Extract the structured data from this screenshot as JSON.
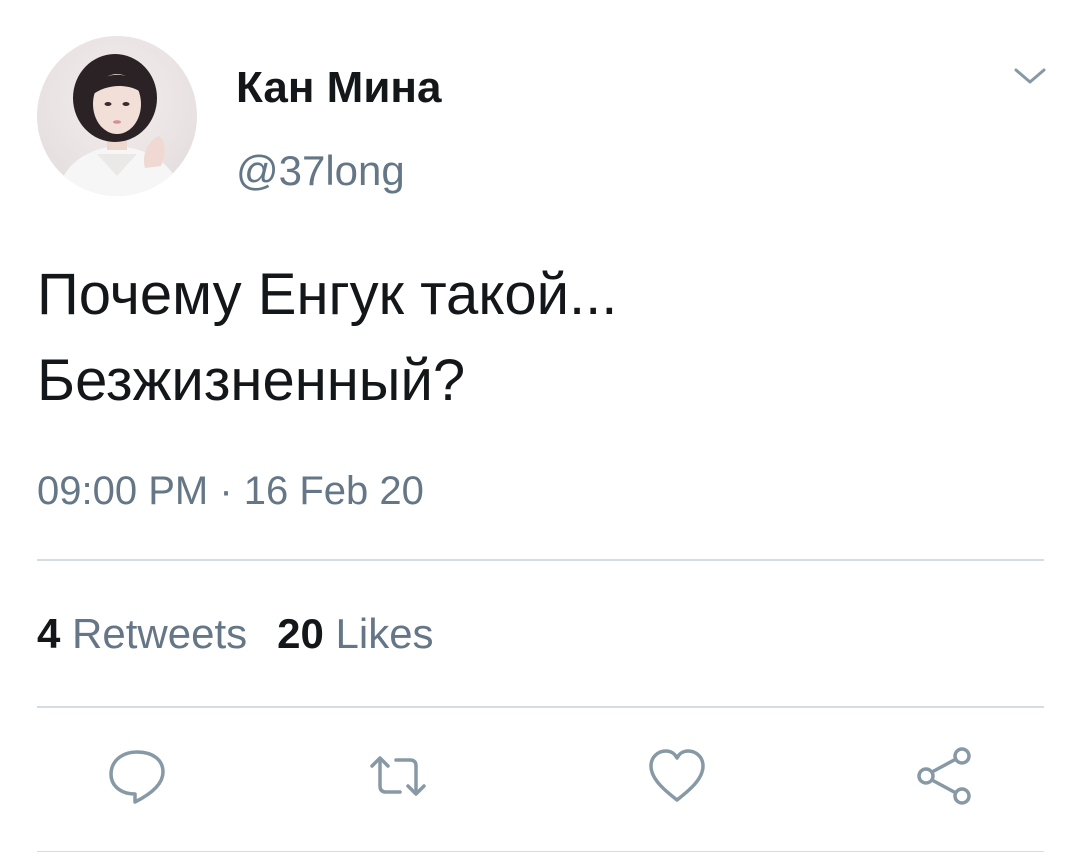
{
  "tweet": {
    "author": {
      "name": "Кан Мина",
      "handle": "@37long"
    },
    "text": "Почему Енгук такой...\nБезжизненный?",
    "timestamp": "09:00 PM · 16 Feb 20",
    "stats": {
      "retweets_count": "4",
      "retweets_label": "Retweets",
      "likes_count": "20",
      "likes_label": "Likes"
    },
    "icons": {
      "menu": "chevron-down-icon",
      "reply": "reply-icon",
      "retweet": "retweet-icon",
      "like": "heart-icon",
      "share": "share-icon"
    },
    "colors": {
      "text": "#14171a",
      "secondary": "#657786",
      "divider": "#d5dce3"
    }
  }
}
